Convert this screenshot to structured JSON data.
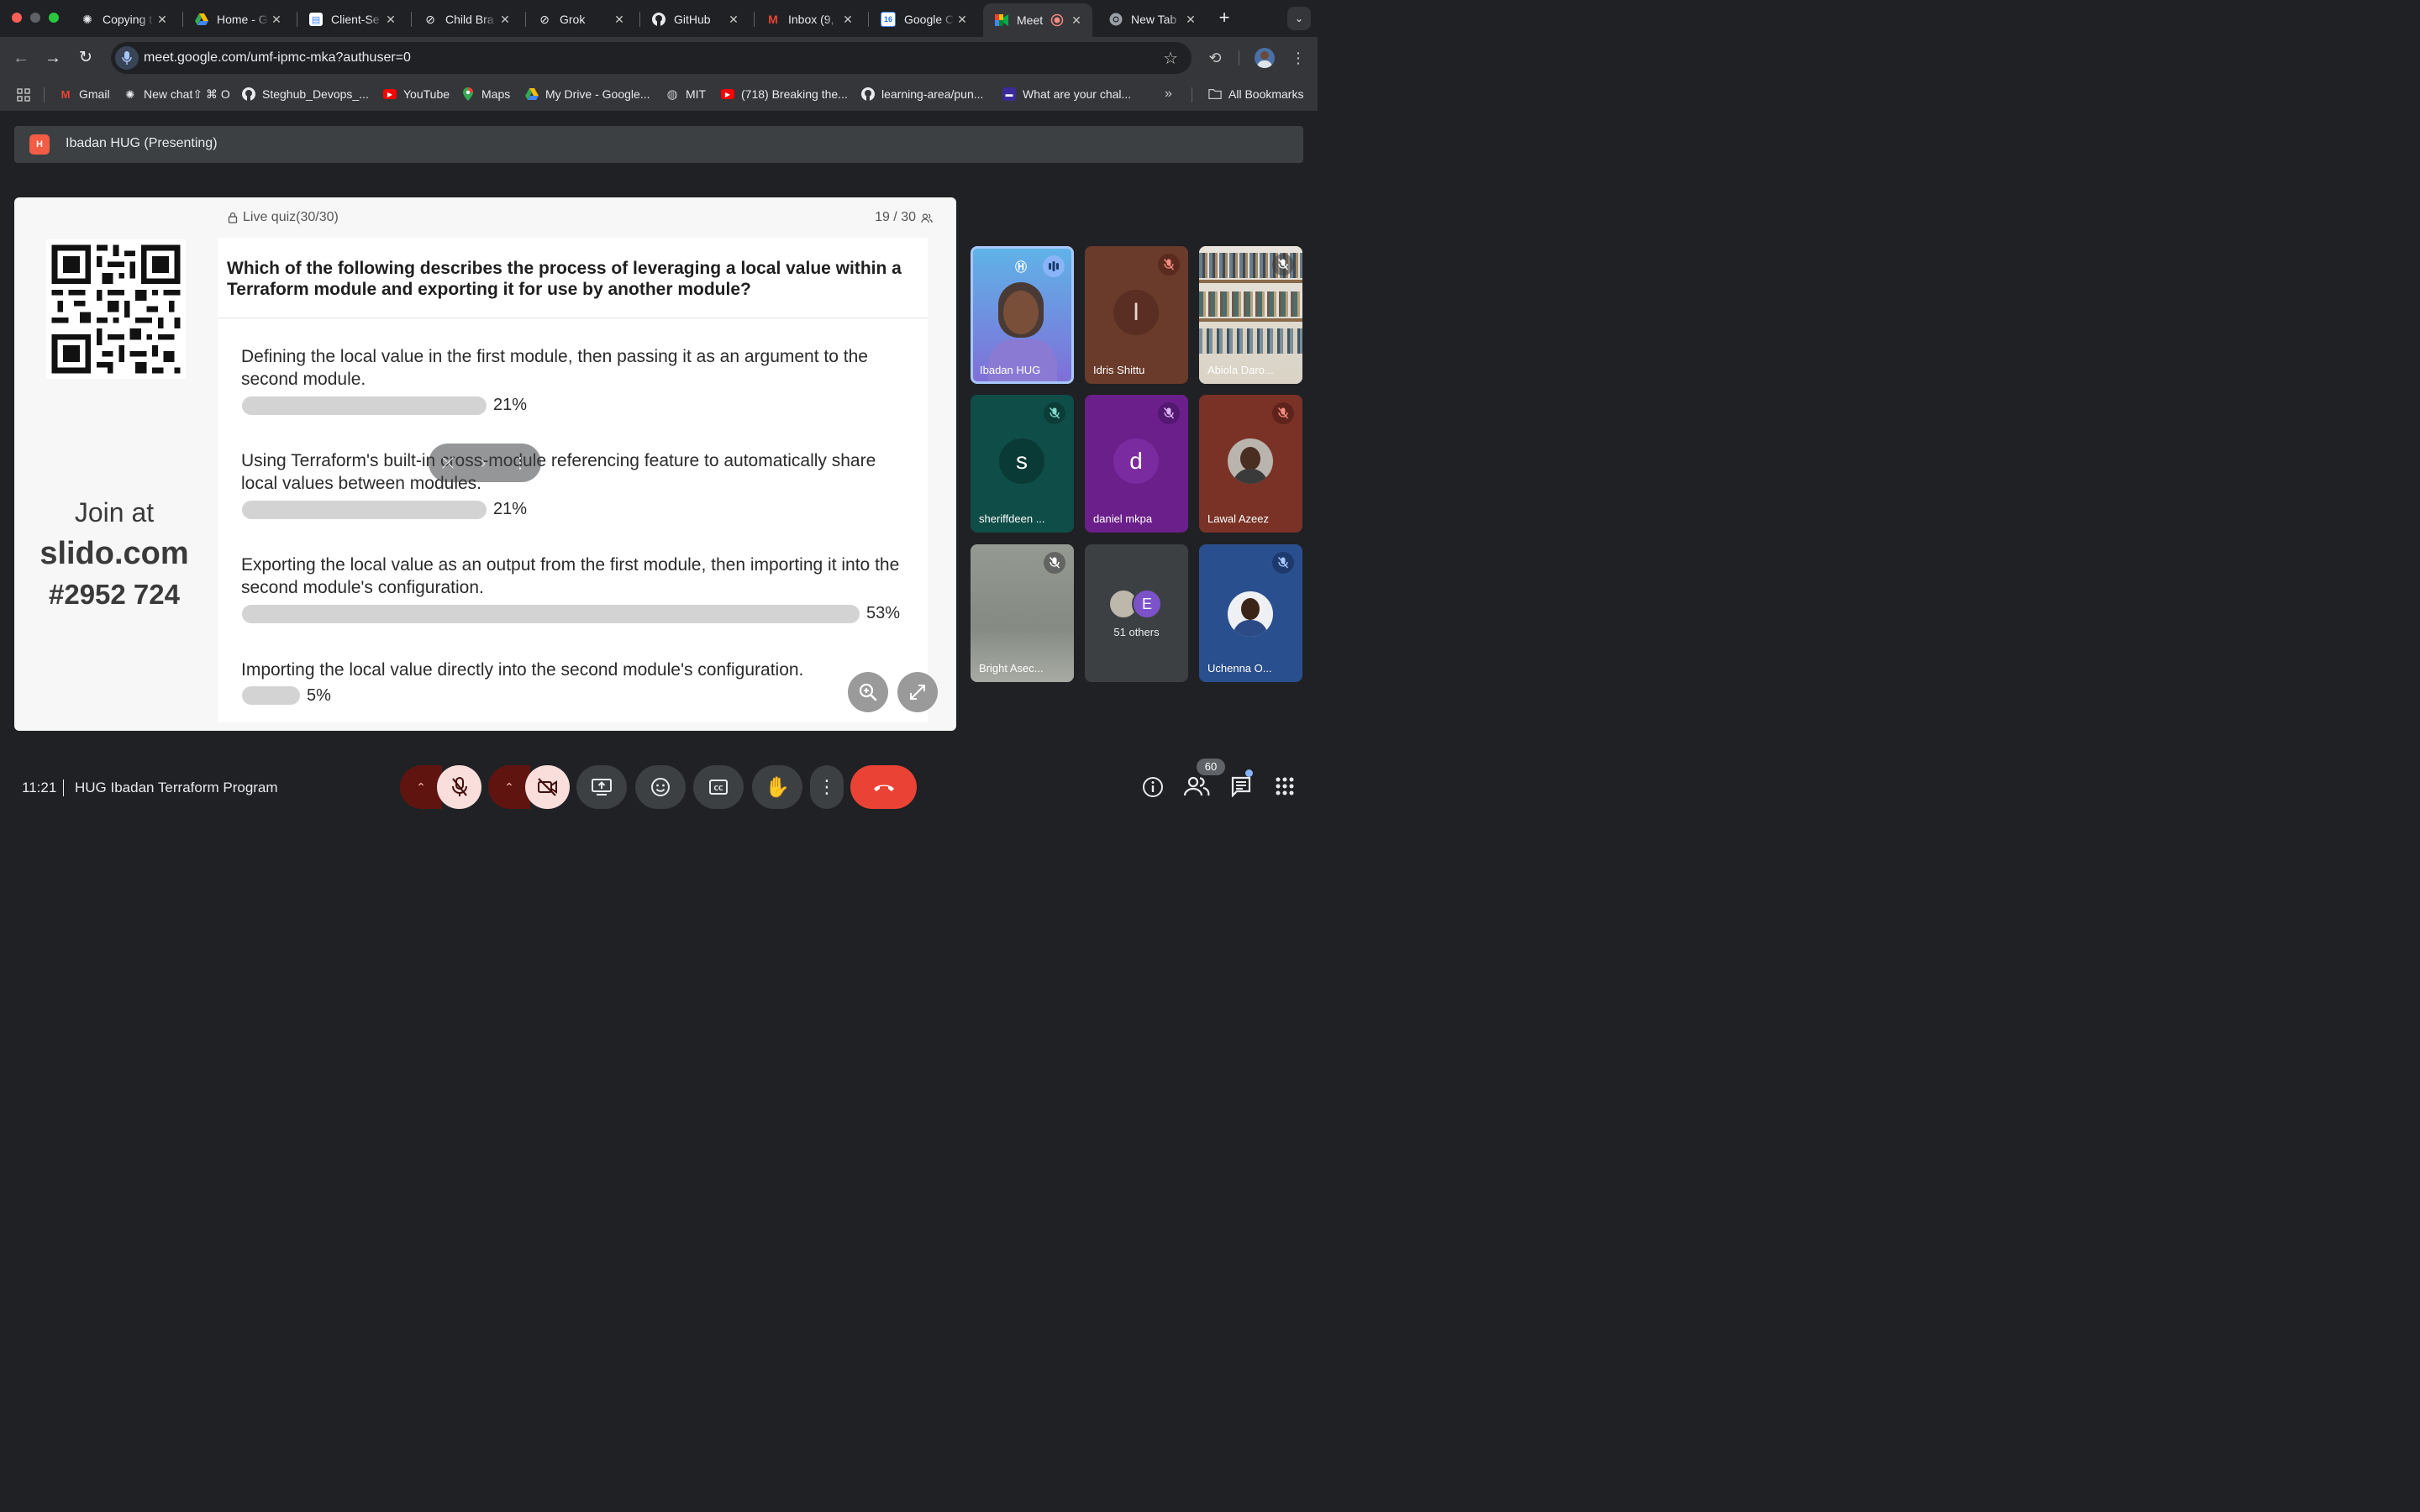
{
  "tabs": [
    {
      "label": "Copying t",
      "icon": "openai-icon"
    },
    {
      "label": "Home - G",
      "icon": "drive-icon"
    },
    {
      "label": "Client-Se",
      "icon": "docs-icon"
    },
    {
      "label": "Child Bra",
      "icon": "grok-icon"
    },
    {
      "label": "Grok",
      "icon": "grok-icon"
    },
    {
      "label": "GitHub",
      "icon": "github-icon"
    },
    {
      "label": "Inbox (9,",
      "icon": "gmail-icon"
    },
    {
      "label": "Google C",
      "icon": "calendar-icon"
    },
    {
      "label": "Meet",
      "icon": "meet-icon",
      "active": true
    },
    {
      "label": "New Tab",
      "icon": "chrome-icon"
    }
  ],
  "address": {
    "url": "meet.google.com/umf-ipmc-mka?authuser=0"
  },
  "bookmarks": [
    {
      "label": "Gmail"
    },
    {
      "label": "New chat⇧ ⌘ O"
    },
    {
      "label": "Steghub_Devops_..."
    },
    {
      "label": "YouTube"
    },
    {
      "label": "Maps"
    },
    {
      "label": "My Drive - Google..."
    },
    {
      "label": "MIT"
    },
    {
      "label": "(718) Breaking the..."
    },
    {
      "label": "learning-area/pun..."
    },
    {
      "label": "What are your chal..."
    },
    {
      "label": "All Bookmarks"
    }
  ],
  "presenter": {
    "title": "Ibadan HUG (Presenting)",
    "logo_text": "H"
  },
  "slide": {
    "join_at": "Join at",
    "site": "slido.com",
    "code": "#2952 724",
    "quiz_label": "Live quiz(30/30)",
    "counter": "19 / 30",
    "question": "Which of the following describes the process of leveraging a local value within a Terraform module and exporting it for use by another module?",
    "options": [
      {
        "text": "Defining the local value in the first module, then passing it as an argument to the second module.",
        "pct_label": "21%",
        "percent": 21
      },
      {
        "text": "Using Terraform's built-in cross-module referencing feature to automatically share local values between modules.",
        "pct_label": "21%",
        "percent": 21
      },
      {
        "text": "Exporting the local value as an output from the first module, then importing it into the second module's configuration.",
        "pct_label": "53%",
        "percent": 53
      },
      {
        "text": "Importing the local value directly into the second module's configuration.",
        "pct_label": "5%",
        "percent": 5
      }
    ]
  },
  "participants": [
    {
      "name": "Ibadan HUG",
      "speaking": true
    },
    {
      "name": "Idris Shittu",
      "initial": "I"
    },
    {
      "name": "Abiola Daro..."
    },
    {
      "name": "sheriffdeen ...",
      "initial": "s"
    },
    {
      "name": "daniel mkpa",
      "initial": "d"
    },
    {
      "name": "Lawal Azeez"
    },
    {
      "name": "Bright Asec..."
    },
    {
      "name": "51 others",
      "initial": "E"
    },
    {
      "name": "Uchenna O..."
    }
  ],
  "meeting": {
    "time": "11:21",
    "name": "HUG Ibadan Terraform Program",
    "people_count": "60"
  },
  "colors": {
    "end_call": "#ea4335",
    "mic_off_bg": "#f9dedc",
    "mic_caret_bg": "#601410",
    "bar": "#d3d3d3",
    "speaking_border": "#a8c7fa"
  }
}
